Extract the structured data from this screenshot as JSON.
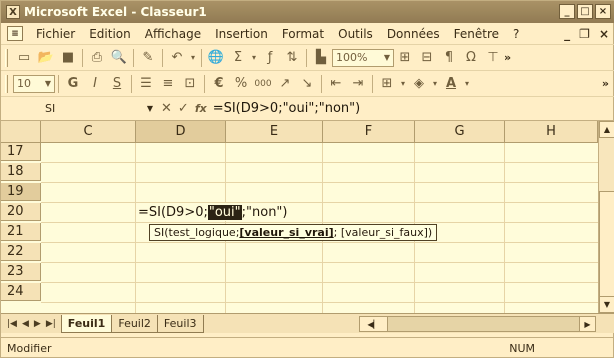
{
  "window": {
    "title": "Microsoft Excel - Classeur1",
    "icon_glyph": "X",
    "minimize": "_",
    "restore": "□",
    "close": "×"
  },
  "menu": {
    "doc_icon_glyph": "≡",
    "items": [
      "Fichier",
      "Edition",
      "Affichage",
      "Insertion",
      "Format",
      "Outils",
      "Données",
      "Fenêtre",
      "?"
    ],
    "right": {
      "minimize": "_",
      "restore": "❐",
      "close": "×"
    }
  },
  "toolbar_standard": {
    "zoom": "100%",
    "icons": [
      "new-icon",
      "open-icon",
      "save-icon",
      "print-icon",
      "print-preview-icon",
      "format-painter-icon",
      "undo-icon",
      "hyperlink-icon",
      "autosum-icon",
      "function-icon",
      "sort-icon",
      "chart-icon",
      "zoom-dropdown",
      "merge-icon",
      "split-icon",
      "text-icon",
      "symbol-icon",
      "more-icon"
    ]
  },
  "toolbar_format": {
    "font_size": "10",
    "bold": "G",
    "italic": "I",
    "underline": "S",
    "currency": "€",
    "percent": "%",
    "thousands": "000",
    "inc_decimal": "↗",
    "dec_decimal": "↘",
    "more": "»"
  },
  "formula_bar": {
    "name_box": "SI",
    "cancel": "✕",
    "enter": "✓",
    "fx": "fx",
    "formula": "=SI(D9>0;\"oui\";\"non\")"
  },
  "grid": {
    "columns": [
      "C",
      "D",
      "E",
      "F",
      "G",
      "H"
    ],
    "rows": [
      "17",
      "18",
      "19",
      "20",
      "21",
      "22",
      "23",
      "24"
    ],
    "selected_column": "D",
    "selected_row": "19",
    "edit_cell": {
      "before": "=SI(D9>0;",
      "highlight": "\"oui\"",
      "after": ";\"non\")"
    },
    "tooltip": {
      "fn": "SI(test_logique; ",
      "current": "[valeur_si_vrai]",
      "rest": "; [valeur_si_faux])"
    }
  },
  "sheets": {
    "tabs": [
      "Feuil1",
      "Feuil2",
      "Feuil3"
    ],
    "active": "Feuil1",
    "nav": [
      "|◀",
      "◀",
      "▶",
      "▶|"
    ]
  },
  "status": {
    "mode": "Modifier",
    "num": "NUM"
  }
}
